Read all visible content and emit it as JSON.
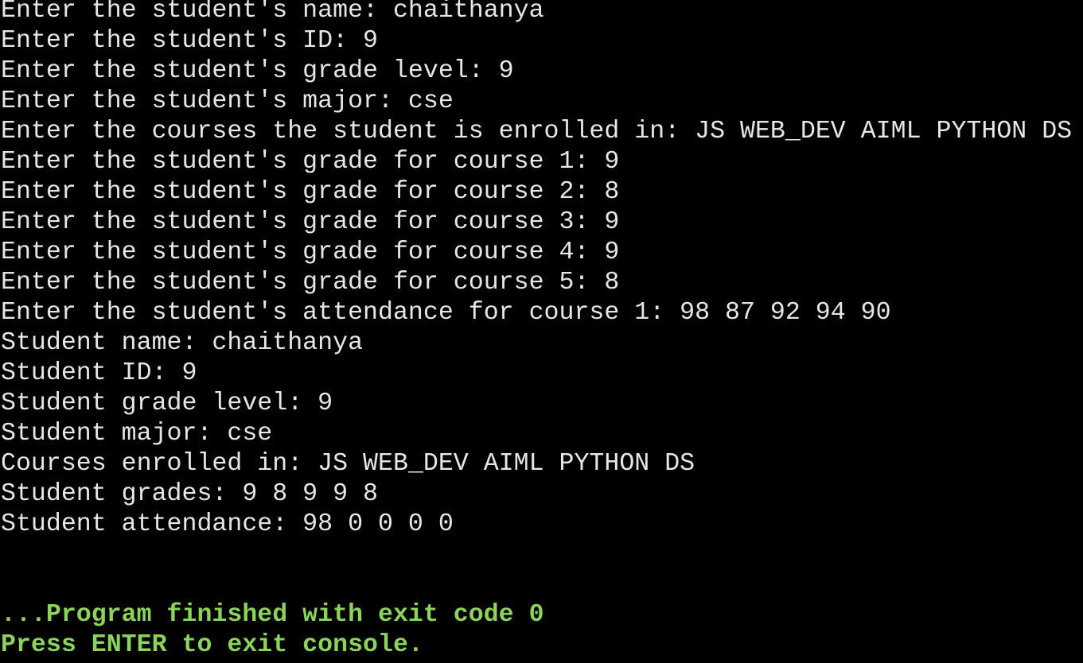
{
  "colors": {
    "background": "#000000",
    "text": "#e6e6e6",
    "status": "#8bd35a"
  },
  "console": {
    "input_lines": [
      {
        "prompt": "Enter the student's name: ",
        "input": "chaithanya"
      },
      {
        "prompt": "Enter the student's ID: ",
        "input": "9"
      },
      {
        "prompt": "Enter the student's grade level: ",
        "input": "9"
      },
      {
        "prompt": "Enter the student's major: ",
        "input": "cse"
      },
      {
        "prompt": "Enter the courses the student is enrolled in: ",
        "input": "JS WEB_DEV AIML PYTHON DS"
      },
      {
        "prompt": "Enter the student's grade for course 1: ",
        "input": "9"
      },
      {
        "prompt": "Enter the student's grade for course 2: ",
        "input": "8"
      },
      {
        "prompt": "Enter the student's grade for course 3: ",
        "input": "9"
      },
      {
        "prompt": "Enter the student's grade for course 4: ",
        "input": "9"
      },
      {
        "prompt": "Enter the student's grade for course 5: ",
        "input": "8"
      },
      {
        "prompt": "Enter the student's attendance for course 1: ",
        "input": "98 87 92 94 90"
      }
    ],
    "output_lines": [
      "Student name: chaithanya",
      "Student ID: 9",
      "Student grade level: 9",
      "Student major: cse",
      "Courses enrolled in: JS WEB_DEV AIML PYTHON DS",
      "Student grades: 9 8 9 9 8",
      "Student attendance: 98 0 0 0 0"
    ],
    "status_lines": [
      "...Program finished with exit code 0",
      "Press ENTER to exit console."
    ]
  }
}
